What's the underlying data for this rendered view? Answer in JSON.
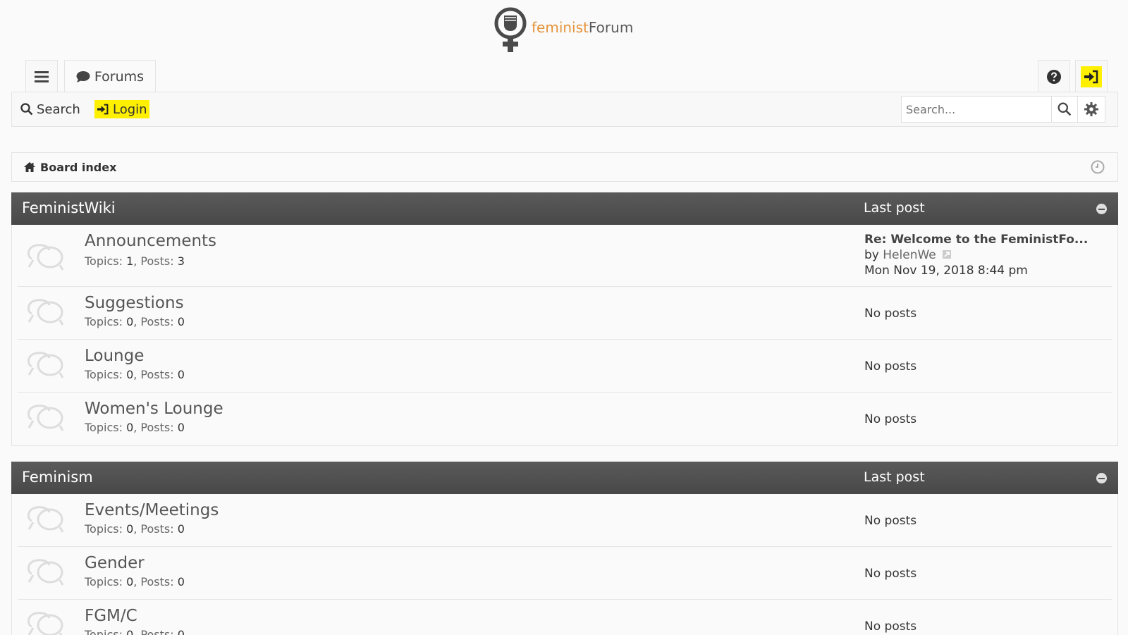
{
  "logo": {
    "part1": "feminist",
    "part2": "Forum",
    "accent": "#e5933a"
  },
  "tabs": {
    "forums_label": "Forums"
  },
  "nav": {
    "search_label": "Search",
    "login_label": "Login",
    "search_placeholder": "Search..."
  },
  "breadcrumb": {
    "label": "Board index"
  },
  "sections": [
    {
      "title": "FeministWiki",
      "last_post_header": "Last post",
      "forums": [
        {
          "name": "Announcements",
          "topics_label": "Topics:",
          "topics": "1",
          "posts_label": "Posts:",
          "posts": "3",
          "last_post": {
            "title": "Re: Welcome to the FeministFo...",
            "by": "by",
            "author": "HelenWe",
            "date": "Mon Nov 19, 2018 8:44 pm"
          }
        },
        {
          "name": "Suggestions",
          "topics_label": "Topics:",
          "topics": "0",
          "posts_label": "Posts:",
          "posts": "0",
          "last_post_text": "No posts"
        },
        {
          "name": "Lounge",
          "topics_label": "Topics:",
          "topics": "0",
          "posts_label": "Posts:",
          "posts": "0",
          "last_post_text": "No posts"
        },
        {
          "name": "Women's Lounge",
          "topics_label": "Topics:",
          "topics": "0",
          "posts_label": "Posts:",
          "posts": "0",
          "last_post_text": "No posts"
        }
      ]
    },
    {
      "title": "Feminism",
      "last_post_header": "Last post",
      "forums": [
        {
          "name": "Events/Meetings",
          "topics_label": "Topics:",
          "topics": "0",
          "posts_label": "Posts:",
          "posts": "0",
          "last_post_text": "No posts"
        },
        {
          "name": "Gender",
          "topics_label": "Topics:",
          "topics": "0",
          "posts_label": "Posts:",
          "posts": "0",
          "last_post_text": "No posts"
        },
        {
          "name": "FGM/C",
          "topics_label": "Topics:",
          "topics": "0",
          "posts_label": "Posts:",
          "posts": "0",
          "last_post_text": "No posts"
        }
      ]
    }
  ],
  "colors": {
    "highlight": "#ffef00",
    "section_header": "#505050"
  }
}
